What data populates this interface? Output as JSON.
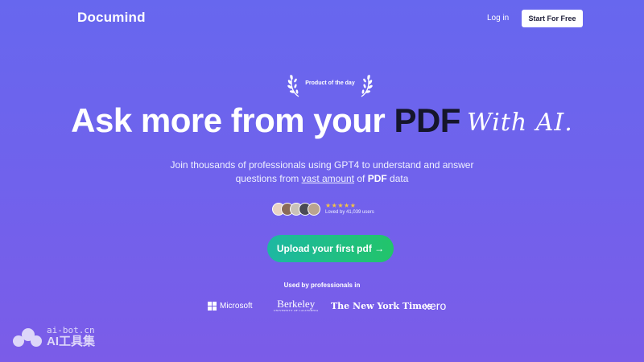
{
  "nav": {
    "logo": "Documind",
    "login_label": "Log in",
    "start_label": "Start For Free"
  },
  "badge": {
    "text": "Product of the day"
  },
  "hero": {
    "headline_main": "Ask more from your ",
    "headline_highlight": "PDF",
    "headline_script": "With AI.",
    "sub_line1": "Join thousands of professionals using GPT4 to understand and answer",
    "sub_line2_prefix": "questions from ",
    "sub_line2_link": "vast amount",
    "sub_line2_mid": " of ",
    "sub_line2_bold": "PDF",
    "sub_line2_suffix": " data"
  },
  "social_proof": {
    "stars": "★★★★★",
    "loved_text": "Loved by 41,039 users",
    "avatar_colors": [
      "#e8d2c4",
      "#8a6b5a",
      "#c9c2b8",
      "#4a4a55",
      "#b9a48f"
    ]
  },
  "cta": {
    "upload_label": "Upload your first pdf →"
  },
  "logos": {
    "heading": "Used by professionals in",
    "microsoft": "Microsoft",
    "berkeley": "Berkeley",
    "berkeley_sub": "UNIVERSITY OF CALIFORNIA",
    "nyt": "The New York Times",
    "xero": "xero"
  },
  "watermark": {
    "top": "ai-bot.cn",
    "bottom": "AI工具集"
  },
  "colors": {
    "bg_top": "#6767ee",
    "bg_bottom": "#7b5ce8",
    "accent_dark": "#15162b",
    "cta_start": "#1db8a2",
    "cta_end": "#22c46a",
    "star": "#f5c442"
  }
}
